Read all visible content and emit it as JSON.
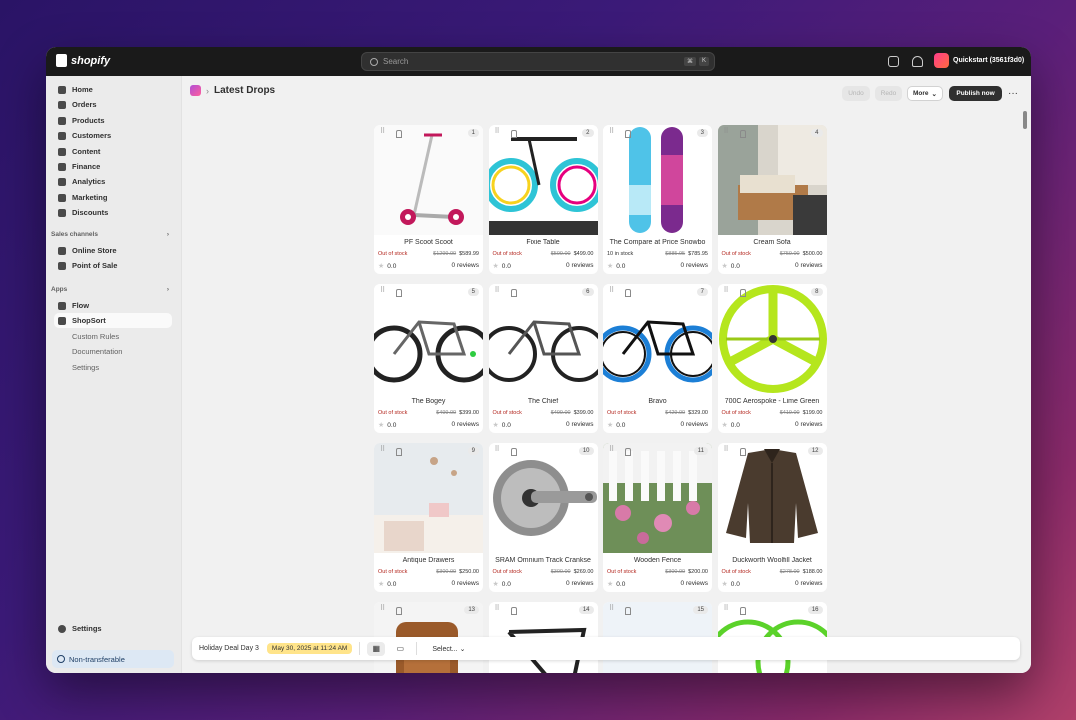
{
  "topbar": {
    "brand": "shopify",
    "search_placeholder": "Search",
    "kbd": [
      "⌘",
      "K"
    ],
    "store_name": "Quickstart (3561f3d0)"
  },
  "sidebar": {
    "items": [
      {
        "label": "Home",
        "icon": "home-icon"
      },
      {
        "label": "Orders",
        "icon": "orders-icon"
      },
      {
        "label": "Products",
        "icon": "tag-icon"
      },
      {
        "label": "Customers",
        "icon": "person-icon"
      },
      {
        "label": "Content",
        "icon": "content-icon"
      },
      {
        "label": "Finance",
        "icon": "bank-icon"
      },
      {
        "label": "Analytics",
        "icon": "chart-icon"
      },
      {
        "label": "Marketing",
        "icon": "target-icon"
      },
      {
        "label": "Discounts",
        "icon": "discount-icon"
      }
    ],
    "sales_channels_label": "Sales channels",
    "sales_channels": [
      {
        "label": "Online Store"
      },
      {
        "label": "Point of Sale"
      }
    ],
    "apps_label": "Apps",
    "apps": [
      {
        "label": "Flow"
      },
      {
        "label": "ShopSort"
      }
    ],
    "app_sub": [
      {
        "label": "Custom Rules"
      },
      {
        "label": "Documentation"
      },
      {
        "label": "Settings"
      }
    ],
    "settings_label": "Settings",
    "nontransferable_label": "Non-transferable"
  },
  "header": {
    "title": "Latest Drops",
    "undo": "Undo",
    "redo": "Redo",
    "more": "More",
    "publish": "Publish now",
    "more_actions": "···"
  },
  "products": [
    {
      "num": "1",
      "title": "PF Scoot Scoot",
      "stock": "Out of stock",
      "old": "$1299.00",
      "price": "$589.99",
      "rating": "0.0",
      "reviews": "0 reviews"
    },
    {
      "num": "2",
      "title": "Fixie Table",
      "stock": "Out of stock",
      "old": "$599.00",
      "price": "$499.00",
      "rating": "0.0",
      "reviews": "0 reviews"
    },
    {
      "num": "3",
      "title": "The Compare at Price Snowbo",
      "stock": "10 in stock",
      "old": "$885.95",
      "price": "$785.95",
      "rating": "0.0",
      "reviews": "0 reviews"
    },
    {
      "num": "4",
      "title": "Cream Sofa",
      "stock": "Out of stock",
      "old": "$759.00",
      "price": "$500.00",
      "rating": "0.0",
      "reviews": "0 reviews"
    },
    {
      "num": "5",
      "title": "The Bogey",
      "stock": "Out of stock",
      "old": "$499.00",
      "price": "$399.00",
      "rating": "0.0",
      "reviews": "0 reviews"
    },
    {
      "num": "6",
      "title": "The Chief",
      "stock": "Out of stock",
      "old": "$499.00",
      "price": "$399.00",
      "rating": "0.0",
      "reviews": "0 reviews"
    },
    {
      "num": "7",
      "title": "Bravo",
      "stock": "Out of stock",
      "old": "$429.00",
      "price": "$329.00",
      "rating": "0.0",
      "reviews": "0 reviews"
    },
    {
      "num": "8",
      "title": "700C Aerospoke - Lime Green",
      "stock": "Out of stock",
      "old": "$419.00",
      "price": "$199.00",
      "rating": "0.0",
      "reviews": "0 reviews"
    },
    {
      "num": "9",
      "title": "Antique Drawers",
      "stock": "Out of stock",
      "old": "$300.00",
      "price": "$250.00",
      "rating": "0.0",
      "reviews": "0 reviews"
    },
    {
      "num": "10",
      "title": "SRAM Omnium Track Crankse",
      "stock": "Out of stock",
      "old": "$300.00",
      "price": "$269.00",
      "rating": "0.0",
      "reviews": "0 reviews"
    },
    {
      "num": "11",
      "title": "Wooden Fence",
      "stock": "Out of stock",
      "old": "$300.00",
      "price": "$200.00",
      "rating": "0.0",
      "reviews": "0 reviews"
    },
    {
      "num": "12",
      "title": "Duckworth Woolfill Jacket",
      "stock": "Out of stock",
      "old": "$278.00",
      "price": "$188.00",
      "rating": "0.0",
      "reviews": "0 reviews"
    },
    {
      "num": "13",
      "title": "",
      "stock": "",
      "old": "",
      "price": "",
      "rating": "",
      "reviews": ""
    },
    {
      "num": "14",
      "title": "",
      "stock": "",
      "old": "",
      "price": "",
      "rating": "",
      "reviews": ""
    },
    {
      "num": "15",
      "title": "",
      "stock": "",
      "old": "",
      "price": "",
      "rating": "",
      "reviews": ""
    },
    {
      "num": "16",
      "title": "",
      "stock": "",
      "old": "",
      "price": "",
      "rating": "",
      "reviews": ""
    }
  ],
  "bottombar": {
    "label": "Holiday Deal Day 3",
    "date": "May 30, 2025 at 11:24 AM",
    "select": "Select..."
  },
  "colors": {
    "out_of_stock": "#b3261e",
    "publish_bg": "#303030",
    "date_highlight": "#ffe48a"
  }
}
